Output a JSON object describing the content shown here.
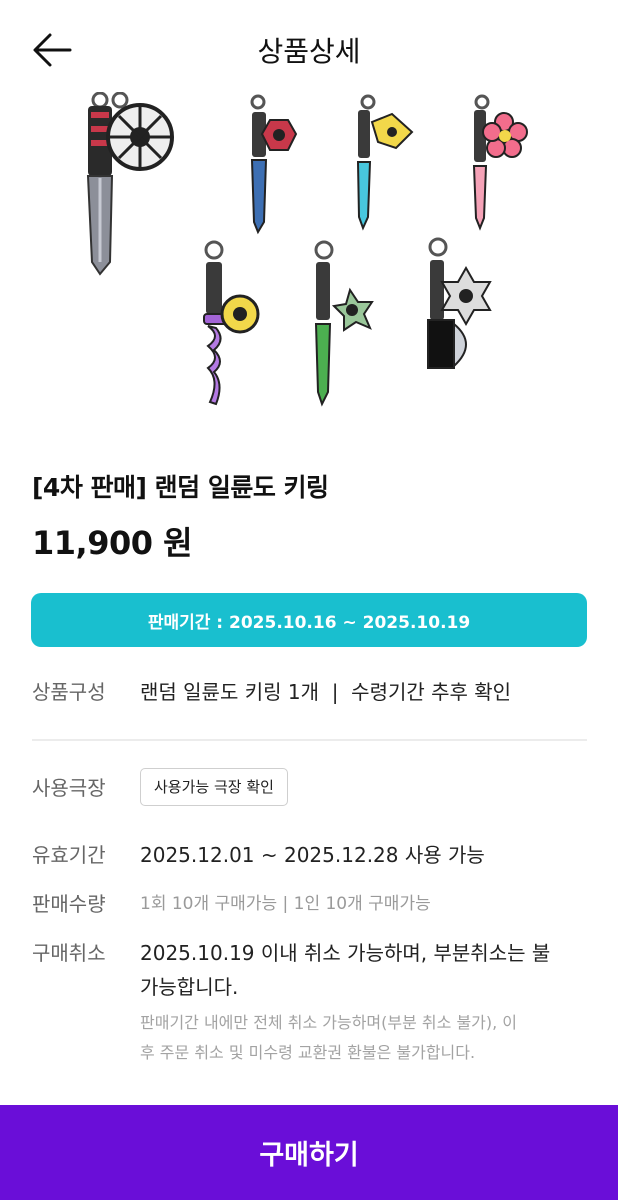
{
  "header": {
    "title": "상품상세",
    "back_icon": "arrow-left-icon"
  },
  "product": {
    "title": "[4차 판매] 랜덤 일륜도 키링",
    "price": "11,900 원",
    "image_alt": "randomly assorted nichirin sword keychains"
  },
  "sale_period": {
    "text": "판매기간 : 2025.10.16 ~ 2025.10.19",
    "color": "#19bfcf"
  },
  "details": {
    "composition": {
      "label": "상품구성",
      "value": "랜덤 일륜도 키링 1개  |  수령기간 추후 확인"
    },
    "theater": {
      "label": "사용극장",
      "button_label": "사용가능 극장 확인"
    },
    "validity": {
      "label": "유효기간",
      "value": "2025.12.01 ~ 2025.12.28 사용 가능"
    },
    "quantity": {
      "label": "판매수량",
      "value": "1회 10개 구매가능 | 1인 10개 구매가능"
    },
    "cancel": {
      "label": "구매취소",
      "value_line1": "2025.10.19 이내 취소 가능하며, 부분취소는 불",
      "value_line2": "가능합니다.",
      "note_line1": "판매기간 내에만 전체 취소 가능하며(부분 취소 불가), 이",
      "note_line2": "후 주문 취소 및 미수령 교환권 환불은 불가합니다."
    }
  },
  "buy_button": {
    "label": "구매하기",
    "color": "#6a0ed8"
  }
}
